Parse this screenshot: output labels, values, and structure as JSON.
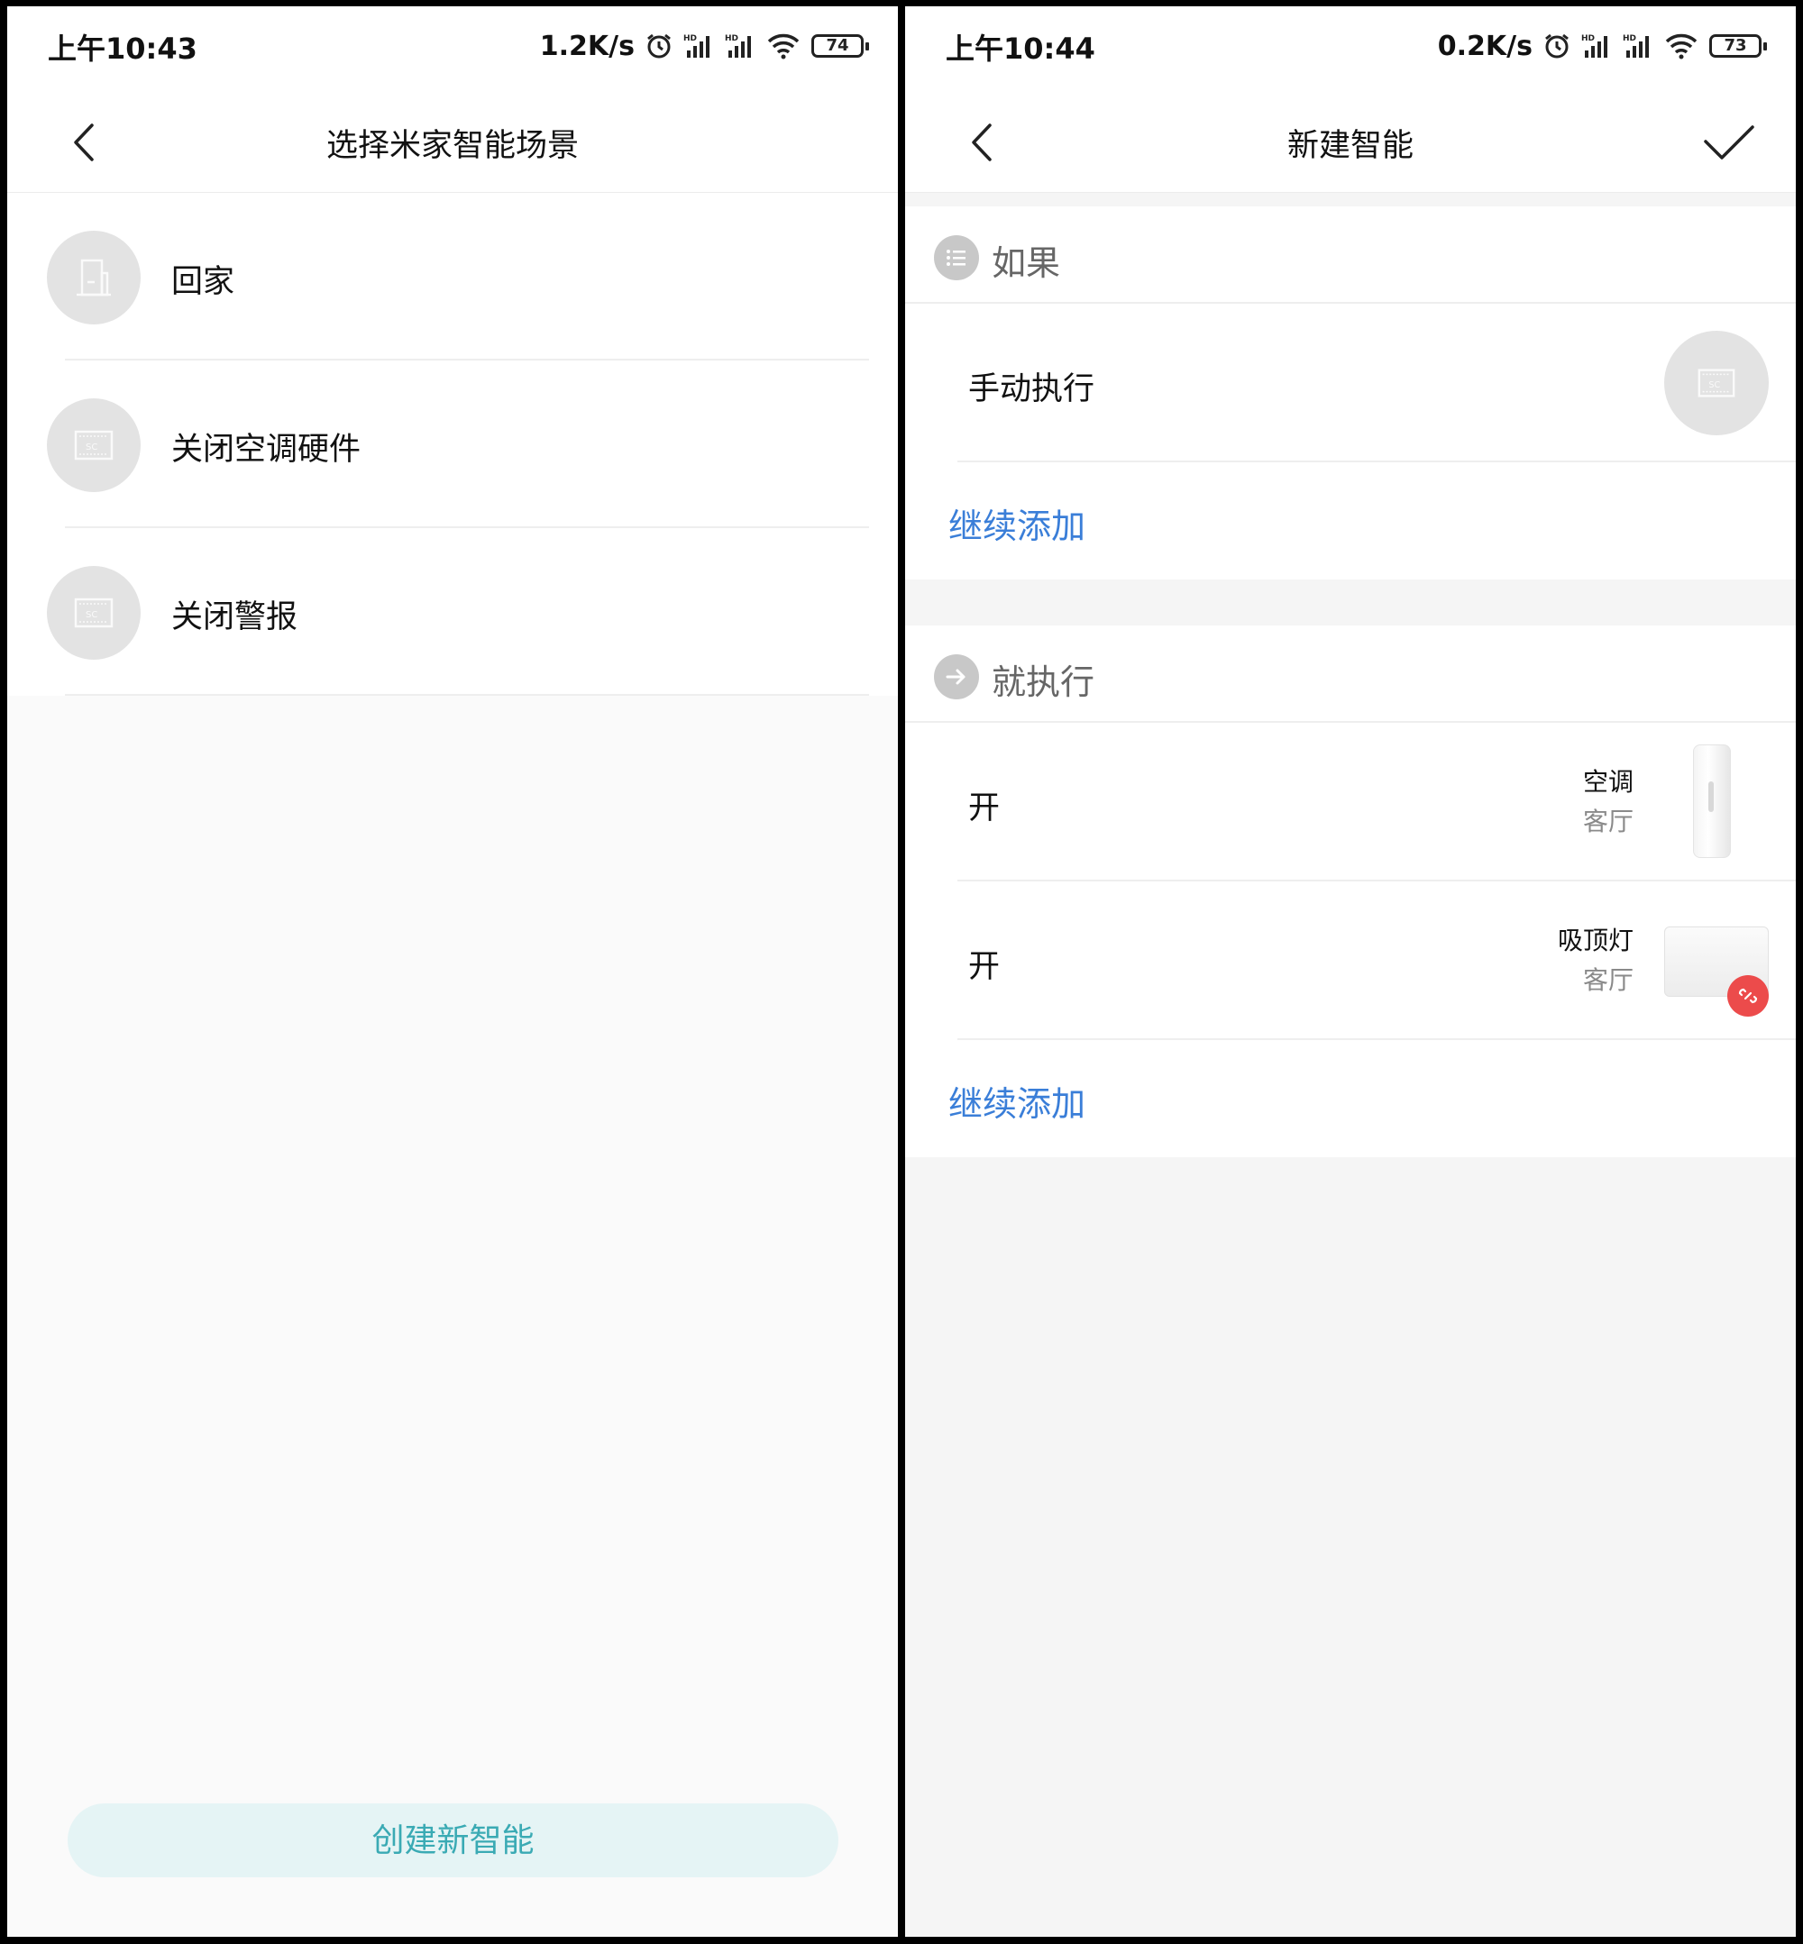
{
  "left": {
    "status": {
      "time": "上午10:43",
      "speed": "1.2K/s",
      "battery": "74"
    },
    "title": "选择米家智能场景",
    "scenes": [
      {
        "label": "回家",
        "icon": "door-icon"
      },
      {
        "label": "关闭空调硬件",
        "icon": "scene-card-icon"
      },
      {
        "label": "关闭警报",
        "icon": "scene-card-icon"
      }
    ],
    "create_button": "创建新智能"
  },
  "right": {
    "status": {
      "time": "上午10:44",
      "speed": "0.2K/s",
      "battery": "73"
    },
    "title": "新建智能",
    "if_section": {
      "title": "如果",
      "condition": "手动执行",
      "add_more": "继续添加"
    },
    "then_section": {
      "title": "就执行",
      "actions": [
        {
          "label": "开",
          "device": "空调",
          "room": "客厅"
        },
        {
          "label": "开",
          "device": "吸顶灯",
          "room": "客厅"
        }
      ],
      "add_more": "继续添加"
    }
  },
  "colors": {
    "accent_blue": "#3a7ed8",
    "create_button_text": "#3aaab4",
    "create_button_bg": "#e5f4f5",
    "unlink_red": "#ec4b4b"
  }
}
